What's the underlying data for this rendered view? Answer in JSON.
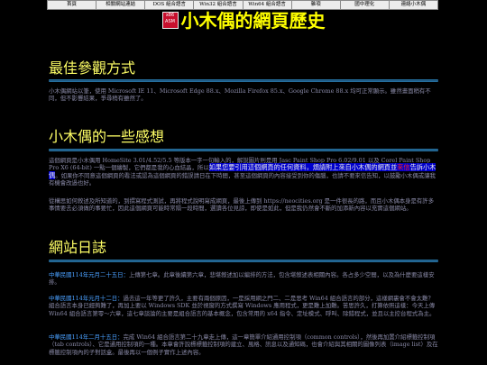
{
  "nav": [
    "首頁",
    "相關網站連結",
    "DOS 組合語言",
    "Win32 組合語言",
    "Win64 組合語言",
    "雜項",
    "國中理化",
    "連絡小木偶"
  ],
  "logo_text": [
    "x86",
    "ASM"
  ],
  "site_title": "小木偶的網頁歷史",
  "sections": [
    {
      "title": "最佳參觀方式",
      "paragraphs": [
        "小木偶網站以筆，使用 Microsoft IE 11、Microsoft Edge 88.x、Mozilla Firefox 85.x、Google Chrome 88.x 均可正常顯示。雖然畫面稍有不同，但不影響結果，爭尋稍有雖然了。"
      ]
    },
    {
      "title": "小木偶的一些感想",
      "p1_a": "這個網頁是小木偶用 HomeSite 3.01/4.52/5.5 等版本一字一句輸入的，解說圖片則是用 Jasc Paint Shop Pro 6.02/9.01 以及 Corel Paint Shop Pro X6 (64-bit) 一點一個繪製，它們都是我的心血結晶，所以",
      "p1_hl_a": "如果您要引用這個網頁的任何資料，煩請附上來自小木偶的網頁並",
      "p1_hl_red": "來信",
      "p1_hl_b": "告訴小木偶",
      "p1_b": "。如果你不同意這個網頁的看法或認為這個網頁的錯誤請日在下時間，甚至這個網頁的內容接受到你的傷腦，也請不要來信告知，以鼓勵小木偶或讓我有機會改過也好。",
      "p2": "從構思如何敘述及所知道的，到撰寫程式測試，再將程式說明寫成網頁，最後上傳到 https://neocities.org 是一件很長的路，而且小木偶本身是有許多事情要去必須做的事要忙，因此這個網頁可能時常隔一段時間，選讀各位見諒，即使是如此，但是我仍然會不斷的加添新內容以充實這個網站。"
    },
    {
      "title": "網站日誌",
      "logs": [
        {
          "date": "中華民國114年元月二十五日：",
          "text": "上傳第七章。此章後續第六章，悲堪敘述加以編排的方法，包含堪敘述表相關內容。各占多少空間，以及為什麼要這樣安排。"
        },
        {
          "date": "中華民國114年元月十二日：",
          "text": "過去這一年等更了許久，主要有兩個原因，一是採用網之門二、二是思考 Win64 組合語言的部分，這樣網裏會不會太難？組合語言本身已經夠難了，再加上要以 Windows SDK 並於視窗的方式撰寫 Windows 應用程式，更是難上加難。苦思許久，打算依照這樣：今天上傳 Win64 組合語言第零～六章，這七章談論的主要是組合語言的基本概念，包含常用的 x64 指令、定址模式、呼叫、除錯程式，並且以主控台程式為主。"
        },
        {
          "date": "中華民國114年二月十五日：",
          "text": "完成 Win64 組合語言第二十九章走上傳，這一章簡單介紹通用控制項（common controls），然後再加置介紹標籤控制項（tab controls）、它是通用控制項的一種。本章會許說標標籤控制項的建立、風格、訊息以及通知碼，也會介紹與其相關的圖像列表（image list）及在標籤控制項內的子對話盒。最後再以一個例子實作上述內容。"
        }
      ]
    }
  ]
}
